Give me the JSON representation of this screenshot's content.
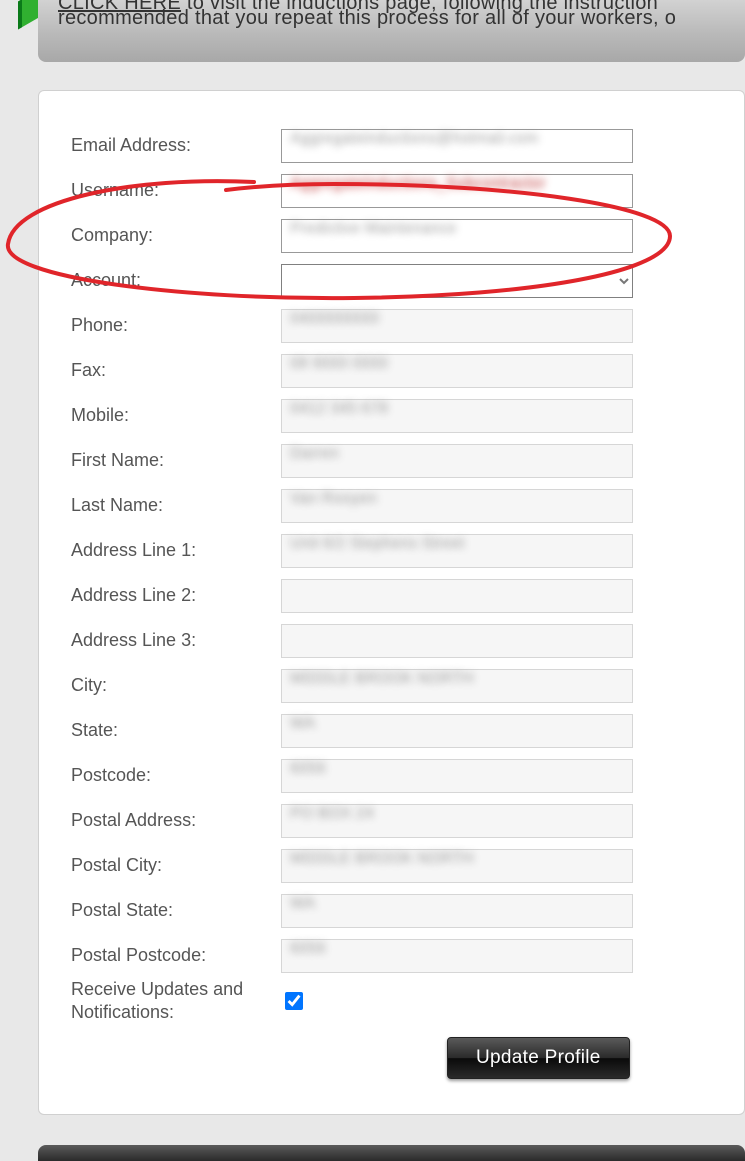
{
  "banner": {
    "link_text": "CLICK HERE",
    "line1_rest": " to visit the inductions page, following the instruction",
    "line2": "recommended that you repeat this process for all of your workers, o"
  },
  "form": {
    "email": {
      "label": "Email Address:",
      "value": "Aggregateinductions@hotmail.com"
    },
    "username": {
      "label": "Username:",
      "value": "AggregateInductions_Subcontractor"
    },
    "company": {
      "label": "Company:",
      "value": "Predictive Maintenance"
    },
    "account": {
      "label": "Account:",
      "value": ""
    },
    "phone": {
      "label": "Phone:",
      "value": "0400000000"
    },
    "fax": {
      "label": "Fax:",
      "value": "08 9000 0000"
    },
    "mobile": {
      "label": "Mobile:",
      "value": "0412 345 678"
    },
    "first_name": {
      "label": "First Name:",
      "value": "Darren"
    },
    "last_name": {
      "label": "Last Name:",
      "value": "Van Rooyen"
    },
    "addr1": {
      "label": "Address Line 1:",
      "value": "Unit 6/2 Stephens Street"
    },
    "addr2": {
      "label": "Address Line 2:",
      "value": ""
    },
    "addr3": {
      "label": "Address Line 3:",
      "value": ""
    },
    "city": {
      "label": "City:",
      "value": "MIDDLE BROOK NORTH"
    },
    "state": {
      "label": "State:",
      "value": "WA"
    },
    "postcode": {
      "label": "Postcode:",
      "value": "6056"
    },
    "paddr": {
      "label": "Postal Address:",
      "value": "PO BOX 24"
    },
    "pcity": {
      "label": "Postal City:",
      "value": "MIDDLE BROOK NORTH"
    },
    "pstate": {
      "label": "Postal State:",
      "value": "WA"
    },
    "ppostcode": {
      "label": "Postal Postcode:",
      "value": "6056"
    },
    "receive": {
      "label": "Receive Updates and Notifications:",
      "checked": true
    }
  },
  "buttons": {
    "update": "Update Profile"
  }
}
